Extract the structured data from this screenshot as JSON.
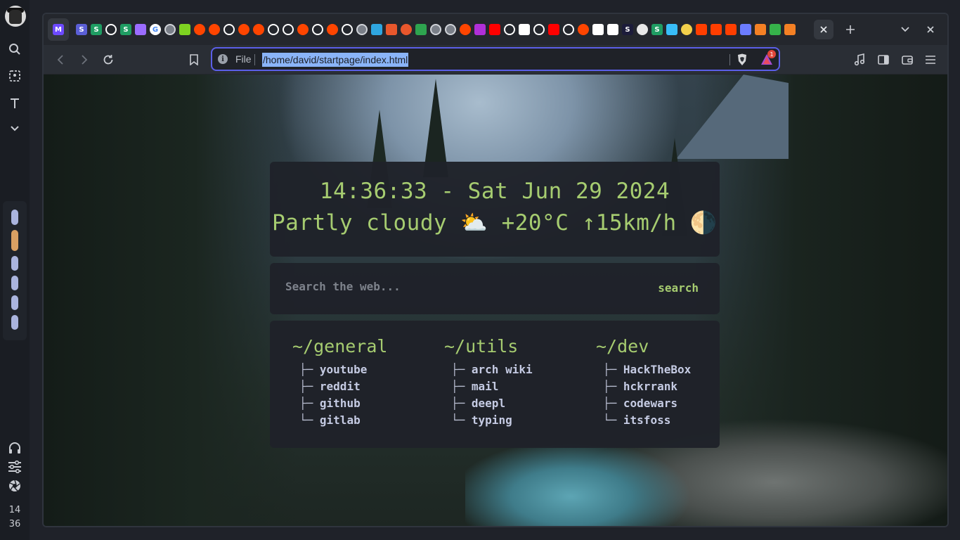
{
  "wm": {
    "clock_hour": "14",
    "clock_min": "36",
    "workspaces": [
      {
        "active": false
      },
      {
        "active": true
      },
      {
        "active": false
      },
      {
        "active": false
      },
      {
        "active": false
      },
      {
        "active": false
      }
    ],
    "colors": {
      "workspace": "#aab4de",
      "workspace_active": "#d9a063"
    }
  },
  "browser": {
    "tabs": [
      {
        "icon": "proton-mail-icon",
        "color": "#6d4aff",
        "glyph": "M",
        "active": true
      },
      {
        "icon": "s-app-icon",
        "color": "#5b5fd6",
        "glyph": "S"
      },
      {
        "icon": "s-app-icon",
        "color": "#1f9d63",
        "glyph": "S"
      },
      {
        "icon": "github-icon",
        "color": "#ffffff",
        "glyph": ""
      },
      {
        "icon": "s-app-icon",
        "color": "#1f9d63",
        "glyph": "S"
      },
      {
        "icon": "diamond-icon",
        "color": "#9b6cff",
        "glyph": ""
      },
      {
        "icon": "google-icon",
        "color": "#ffffff",
        "glyph": "G"
      },
      {
        "icon": "globe-icon",
        "color": "#7a7f88",
        "glyph": ""
      },
      {
        "icon": "cube-icon",
        "color": "#7ed321",
        "glyph": ""
      },
      {
        "icon": "reddit-icon",
        "color": "#ff4500",
        "glyph": ""
      },
      {
        "icon": "reddit-icon",
        "color": "#ff4500",
        "glyph": ""
      },
      {
        "icon": "github-icon",
        "color": "#ffffff",
        "glyph": ""
      },
      {
        "icon": "reddit-icon",
        "color": "#ff4500",
        "glyph": ""
      },
      {
        "icon": "reddit-icon",
        "color": "#ff4500",
        "glyph": ""
      },
      {
        "icon": "github-icon",
        "color": "#ffffff",
        "glyph": ""
      },
      {
        "icon": "github-icon",
        "color": "#ffffff",
        "glyph": ""
      },
      {
        "icon": "reddit-icon",
        "color": "#ff4500",
        "glyph": ""
      },
      {
        "icon": "github-icon",
        "color": "#ffffff",
        "glyph": ""
      },
      {
        "icon": "reddit-icon",
        "color": "#ff4500",
        "glyph": ""
      },
      {
        "icon": "github-icon",
        "color": "#ffffff",
        "glyph": ""
      },
      {
        "icon": "globe-icon",
        "color": "#7a7f88",
        "glyph": ""
      },
      {
        "icon": "drop-icon",
        "color": "#2fa6e0",
        "glyph": ""
      },
      {
        "icon": "flame-icon",
        "color": "#e8572c",
        "glyph": ""
      },
      {
        "icon": "orange-circle-icon",
        "color": "#e8572c",
        "glyph": ""
      },
      {
        "icon": "infinity-icon",
        "color": "#2ea44f",
        "glyph": ""
      },
      {
        "icon": "globe-icon",
        "color": "#7a7f88",
        "glyph": ""
      },
      {
        "icon": "globe-icon",
        "color": "#7a7f88",
        "glyph": ""
      },
      {
        "icon": "reddit-icon",
        "color": "#ff4500",
        "glyph": ""
      },
      {
        "icon": "bars-icon",
        "color": "#b02fd8",
        "glyph": ""
      },
      {
        "icon": "youtube-icon",
        "color": "#ff0000",
        "glyph": ""
      },
      {
        "icon": "github-icon",
        "color": "#ffffff",
        "glyph": ""
      },
      {
        "icon": "qr-icon",
        "color": "#ffffff",
        "glyph": ""
      },
      {
        "icon": "github-icon",
        "color": "#ffffff",
        "glyph": ""
      },
      {
        "icon": "youtube-icon",
        "color": "#ff0000",
        "glyph": ""
      },
      {
        "icon": "github-icon",
        "color": "#ffffff",
        "glyph": ""
      },
      {
        "icon": "reddit-icon",
        "color": "#ff4500",
        "glyph": ""
      },
      {
        "icon": "box-icon",
        "color": "#ffffff",
        "glyph": ""
      },
      {
        "icon": "box-icon",
        "color": "#ffffff",
        "glyph": ""
      },
      {
        "icon": "s-app-icon",
        "color": "#1c1c3a",
        "glyph": "S"
      },
      {
        "icon": "leaf-icon",
        "color": "#e8e8e8",
        "glyph": ""
      },
      {
        "icon": "s-app-icon",
        "color": "#1f9d63",
        "glyph": "S"
      },
      {
        "icon": "tailwind-icon",
        "color": "#38bdf8",
        "glyph": ""
      },
      {
        "icon": "bulb-icon",
        "color": "#f2d04b",
        "glyph": ""
      },
      {
        "icon": "svelte-icon",
        "color": "#ff3e00",
        "glyph": ""
      },
      {
        "icon": "svelte-icon",
        "color": "#ff3e00",
        "glyph": ""
      },
      {
        "icon": "svelte-icon",
        "color": "#ff3e00",
        "glyph": ""
      },
      {
        "icon": "code-icon",
        "color": "#6b7cff",
        "glyph": ""
      },
      {
        "icon": "stackoverflow-icon",
        "color": "#f48024",
        "glyph": ""
      },
      {
        "icon": "dna-icon",
        "color": "#36b24a",
        "glyph": ""
      },
      {
        "icon": "stackoverflow-icon",
        "color": "#f48024",
        "glyph": ""
      }
    ],
    "url": {
      "scheme_label": "File",
      "path": "/home/david/startpage/index.html",
      "rewards_count": "1"
    }
  },
  "startpage": {
    "clock_line": "14:36:33 - Sat Jun 29 2024",
    "weather_line": "Partly cloudy ⛅️  +20°C ↑15km/h 🌗",
    "search": {
      "placeholder": "Search the web...",
      "button": "search"
    },
    "columns": [
      {
        "title": "~/general",
        "links": [
          {
            "branch": "├─",
            "label": "youtube"
          },
          {
            "branch": "├─",
            "label": "reddit"
          },
          {
            "branch": "├─",
            "label": "github"
          },
          {
            "branch": "└─",
            "label": "gitlab"
          }
        ]
      },
      {
        "title": "~/utils",
        "links": [
          {
            "branch": "├─",
            "label": "arch wiki"
          },
          {
            "branch": "├─",
            "label": "mail"
          },
          {
            "branch": "├─",
            "label": "deepl"
          },
          {
            "branch": "└─",
            "label": "typing"
          }
        ]
      },
      {
        "title": "~/dev",
        "links": [
          {
            "branch": "├─",
            "label": "HackTheBox"
          },
          {
            "branch": "├─",
            "label": "hckrrank"
          },
          {
            "branch": "├─",
            "label": "codewars"
          },
          {
            "branch": "└─",
            "label": "itsfoss"
          }
        ]
      }
    ],
    "colors": {
      "accent": "#a6cc70",
      "link": "#c5cbe3",
      "card": "#1f2229"
    }
  }
}
